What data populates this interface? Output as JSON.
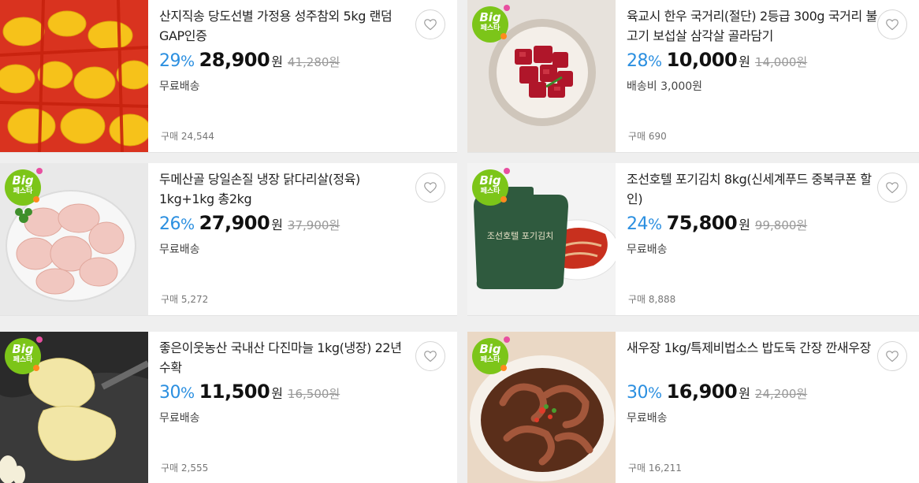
{
  "badge": {
    "line1": "Big",
    "line2": "페스타"
  },
  "products": [
    {
      "title": "산지직송 당도선별 가정용 성주참외 5kg 랜덤 GAP인증",
      "rate": "29",
      "pct": "%",
      "price": "28,900",
      "won": "원",
      "orig": "41,280원",
      "ship": "무료배송",
      "sold": "구매 24,544",
      "image": "korean-melon"
    },
    {
      "title": "육교시 한우 국거리(절단) 2등급 300g 국거리 불고기 보섭살 삼각살 골라담기",
      "rate": "28",
      "pct": "%",
      "price": "10,000",
      "won": "원",
      "orig": "14,000원",
      "ship": "배송비 3,000원",
      "sold": "구매 690",
      "image": "beef"
    },
    {
      "title": "두메산골 당일손질 냉장 닭다리살(정육) 1kg+1kg 총2kg",
      "rate": "26",
      "pct": "%",
      "price": "27,900",
      "won": "원",
      "orig": "37,900원",
      "ship": "무료배송",
      "sold": "구매 5,272",
      "image": "chicken-thigh"
    },
    {
      "title": "조선호텔 포기김치 8kg(신세계푸드 중복쿠폰 할인)",
      "rate": "24",
      "pct": "%",
      "price": "75,800",
      "won": "원",
      "orig": "99,800원",
      "ship": "무료배송",
      "sold": "구매 8,888",
      "image": "kimchi",
      "pack_text": "조선호텔 포기김치"
    },
    {
      "title": "좋은이웃농산 국내산 다진마늘 1kg(냉장) 22년수확",
      "rate": "30",
      "pct": "%",
      "price": "11,500",
      "won": "원",
      "orig": "16,500원",
      "ship": "무료배송",
      "sold": "구매 2,555",
      "image": "minced-garlic"
    },
    {
      "title": "새우장 1kg/특제비법소스 밥도둑 간장 깐새우장",
      "rate": "30",
      "pct": "%",
      "price": "16,900",
      "won": "원",
      "orig": "24,200원",
      "ship": "무료배송",
      "sold": "구매 16,211",
      "image": "soy-shrimp"
    }
  ],
  "colors": {
    "rate": "#2b8fe0",
    "badge": "#7cc519"
  },
  "icons": {
    "wishlist": "heart-outline-icon"
  }
}
